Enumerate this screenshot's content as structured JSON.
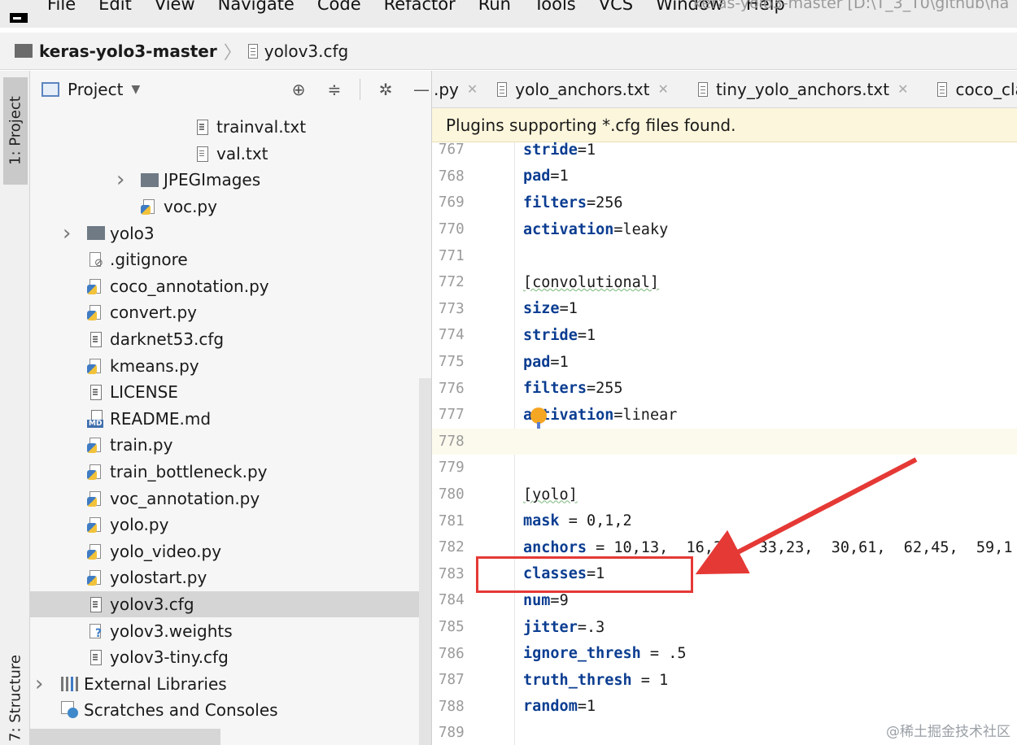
{
  "menu": {
    "items": [
      "File",
      "Edit",
      "View",
      "Navigate",
      "Code",
      "Refactor",
      "Run",
      "Tools",
      "VCS",
      "Window",
      "Help"
    ],
    "title": "keras-yolo3-master [D:\\T_3_T0\\github\\ha"
  },
  "breadcrumb": {
    "root": "keras-yolo3-master",
    "file": "yolov3.cfg"
  },
  "toolstrip": {
    "project_tab": "1: Project",
    "structure_tab": "7: Structure"
  },
  "project_panel": {
    "title": "Project",
    "tree": [
      {
        "label": "trainval.txt",
        "icon": "text-file-icon",
        "indent": 2
      },
      {
        "label": "val.txt",
        "icon": "text-file-icon",
        "indent": 2
      },
      {
        "label": "JPEGImages",
        "icon": "folder-icon",
        "indent": 1,
        "collapsed": true
      },
      {
        "label": "voc.py",
        "icon": "python-file-icon",
        "indent": 1
      },
      {
        "label": "yolo3",
        "icon": "folder-icon",
        "indent": 0,
        "collapsed": true
      },
      {
        "label": ".gitignore",
        "icon": "gitignore-icon",
        "indent": 0
      },
      {
        "label": "coco_annotation.py",
        "icon": "python-file-icon",
        "indent": 0
      },
      {
        "label": "convert.py",
        "icon": "python-file-icon",
        "indent": 0
      },
      {
        "label": "darknet53.cfg",
        "icon": "text-file-icon",
        "indent": 0
      },
      {
        "label": "kmeans.py",
        "icon": "python-file-icon",
        "indent": 0
      },
      {
        "label": "LICENSE",
        "icon": "text-file-icon",
        "indent": 0
      },
      {
        "label": "README.md",
        "icon": "markdown-file-icon",
        "indent": 0
      },
      {
        "label": "train.py",
        "icon": "python-file-icon",
        "indent": 0
      },
      {
        "label": "train_bottleneck.py",
        "icon": "python-file-icon",
        "indent": 0
      },
      {
        "label": "voc_annotation.py",
        "icon": "python-file-icon",
        "indent": 0
      },
      {
        "label": "yolo.py",
        "icon": "python-file-icon",
        "indent": 0
      },
      {
        "label": "yolo_video.py",
        "icon": "python-file-icon",
        "indent": 0
      },
      {
        "label": "yolostart.py",
        "icon": "python-file-icon",
        "indent": 0
      },
      {
        "label": "yolov3.cfg",
        "icon": "text-file-icon",
        "indent": 0,
        "selected": true
      },
      {
        "label": "yolov3.weights",
        "icon": "weights-file-icon",
        "indent": 0
      },
      {
        "label": "yolov3-tiny.cfg",
        "icon": "text-file-icon",
        "indent": 0
      },
      {
        "label": "External Libraries",
        "icon": "library-icon",
        "indent": -1,
        "collapsed": true
      },
      {
        "label": "Scratches and Consoles",
        "icon": "scratches-icon",
        "indent": -1
      }
    ]
  },
  "editor": {
    "tabs": [
      {
        "label": ".py"
      },
      {
        "label": "yolo_anchors.txt"
      },
      {
        "label": "tiny_yolo_anchors.txt"
      },
      {
        "label": "coco_classes"
      }
    ],
    "banner": "Plugins supporting *.cfg files found.",
    "lines": [
      {
        "n": "767",
        "key": "stride",
        "sep": "=",
        "val": "1"
      },
      {
        "n": "768",
        "key": "pad",
        "sep": "=",
        "val": "1"
      },
      {
        "n": "769",
        "key": "filters",
        "sep": "=",
        "val": "256"
      },
      {
        "n": "770",
        "key": "activation",
        "sep": "=",
        "val": "leaky"
      },
      {
        "n": "771",
        "section": ""
      },
      {
        "n": "772",
        "section": "[convolutional]"
      },
      {
        "n": "773",
        "key": "size",
        "sep": "=",
        "val": "1"
      },
      {
        "n": "774",
        "key": "stride",
        "sep": "=",
        "val": "1"
      },
      {
        "n": "775",
        "key": "pad",
        "sep": "=",
        "val": "1"
      },
      {
        "n": "776",
        "key": "filters",
        "sep": "=",
        "val": "255"
      },
      {
        "n": "777",
        "key": "activation",
        "sep": "=",
        "val": "linear"
      },
      {
        "n": "778",
        "section": "",
        "current": true
      },
      {
        "n": "779",
        "section": ""
      },
      {
        "n": "780",
        "section": "[yolo]"
      },
      {
        "n": "781",
        "key": "mask",
        "sep": " = ",
        "val": "0,1,2"
      },
      {
        "n": "782",
        "key": "anchors",
        "sep": " = ",
        "val": "10,13,  16,30,  33,23,  30,61,  62,45,  59,1"
      },
      {
        "n": "783",
        "key": "classes",
        "sep": "=",
        "val": "1"
      },
      {
        "n": "784",
        "key": "num",
        "sep": "=",
        "val": "9"
      },
      {
        "n": "785",
        "key": "jitter",
        "sep": "=",
        "val": ".3"
      },
      {
        "n": "786",
        "key": "ignore_thresh",
        "sep": " = ",
        "val": ".5"
      },
      {
        "n": "787",
        "key": "truth_thresh",
        "sep": " = ",
        "val": "1"
      },
      {
        "n": "788",
        "key": "random",
        "sep": "=",
        "val": "1"
      },
      {
        "n": "789",
        "section": ""
      }
    ]
  },
  "watermark": "@稀土掘金技术社区",
  "colors": {
    "highlight": "#e53935",
    "keyword": "#0b3d91",
    "banner": "#fbf6dc",
    "selection": "#d5d5d5"
  }
}
